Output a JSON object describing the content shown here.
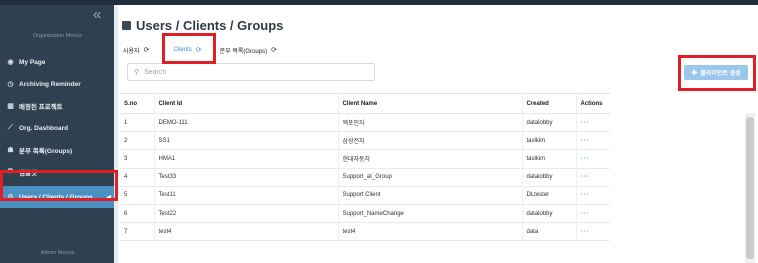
{
  "sidebar": {
    "collapse_icon": "double-chevron-left-icon",
    "org_menus_label": "Organization Menus",
    "admin_menus_label": "Admin Menus",
    "items": [
      {
        "label": "My Page",
        "icon": "user-circle-icon"
      },
      {
        "label": "Archiving Reminder",
        "icon": "clock-icon"
      },
      {
        "label": "배정된 프로젝트",
        "icon": "grid-icon"
      },
      {
        "label": "Org. Dashboard",
        "icon": "chart-icon"
      },
      {
        "label": "분부 목록(Groups)",
        "icon": "users-icon"
      },
      {
        "label": "템플릿",
        "icon": "template-icon"
      },
      {
        "label": "Users / Clients / Groups",
        "icon": "gear-icon",
        "active": true
      }
    ]
  },
  "main": {
    "title": "Users / Clients / Groups",
    "tabs": [
      {
        "label": "사용자",
        "active": false
      },
      {
        "label": "Clients",
        "active": true
      },
      {
        "label": "분부 목록(Groups)",
        "active": false
      }
    ],
    "search": {
      "placeholder": "Search",
      "value": ""
    },
    "create_button": {
      "label": "클라이언트 생성"
    }
  },
  "table": {
    "headers": [
      "S.no",
      "Client Id",
      "Client Name",
      "Created",
      "Actions"
    ],
    "rows": [
      {
        "sno": "1",
        "client_id": "DEMO-111",
        "client_name": "엑포인자",
        "created": "datalobby",
        "actions": "···"
      },
      {
        "sno": "2",
        "client_id": "SS1",
        "client_name": "삼성전자",
        "created": "taslkim",
        "actions": "···"
      },
      {
        "sno": "3",
        "client_id": "HMA1",
        "client_name": "현대자동차",
        "created": "taslkim",
        "actions": "···"
      },
      {
        "sno": "4",
        "client_id": "Test33",
        "client_name": "Support_at_Group",
        "created": "datalobby",
        "actions": "···"
      },
      {
        "sno": "5",
        "client_id": "Test11",
        "client_name": "Support Client",
        "created": "DLtester",
        "actions": "···"
      },
      {
        "sno": "6",
        "client_id": "Test22",
        "client_name": "Support_NameChange",
        "created": "datalobby",
        "actions": "···"
      },
      {
        "sno": "7",
        "client_id": "test4",
        "client_name": "test4",
        "created": "data",
        "actions": "···"
      }
    ]
  },
  "colors": {
    "sidebar_bg": "#2f4050",
    "active_item": "#4a90c2",
    "accent": "#3b8fd1",
    "highlight": "#e01e26",
    "create_button": "#9cc7ea"
  }
}
